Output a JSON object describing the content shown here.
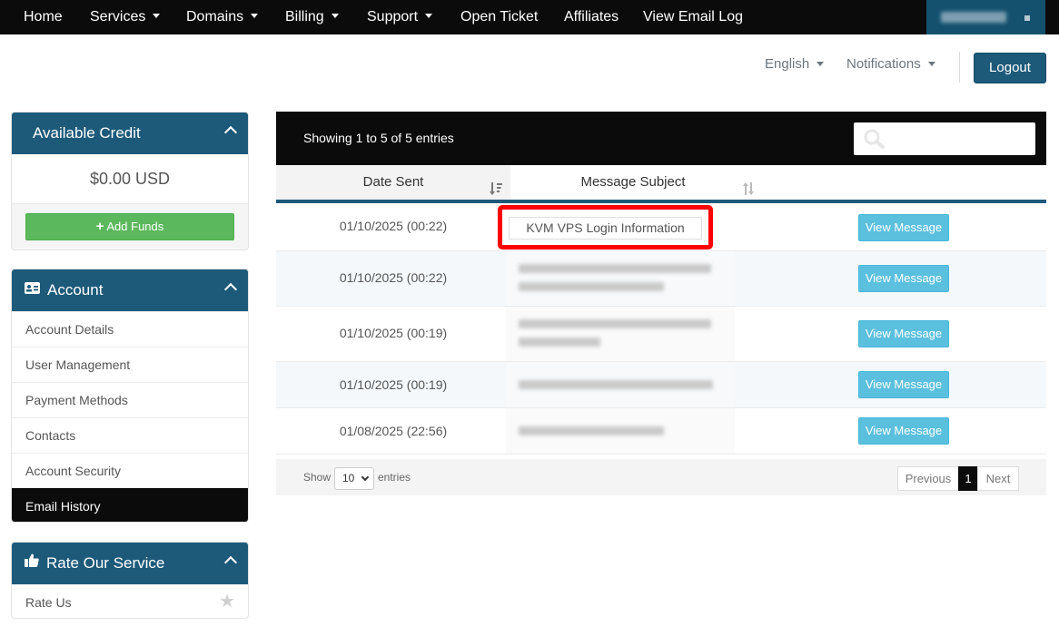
{
  "nav": {
    "items": [
      {
        "label": "Home"
      },
      {
        "label": "Services"
      },
      {
        "label": "Domains"
      },
      {
        "label": "Billing"
      },
      {
        "label": "Support"
      },
      {
        "label": "Open Ticket"
      },
      {
        "label": "Affiliates"
      },
      {
        "label": "View Email Log"
      }
    ]
  },
  "header": {
    "language": "English",
    "notifications": "Notifications",
    "logout": "Logout"
  },
  "sidebar": {
    "credit": {
      "title": "Available Credit",
      "amount": "$0.00 USD",
      "add_funds": "Add Funds"
    },
    "account": {
      "title": "Account",
      "items": [
        {
          "label": "Account Details"
        },
        {
          "label": "User Management"
        },
        {
          "label": "Payment Methods"
        },
        {
          "label": "Contacts"
        },
        {
          "label": "Account Security"
        },
        {
          "label": "Email History"
        }
      ],
      "active_item": "Email History"
    },
    "rate": {
      "title": "Rate Our Service",
      "item": "Rate Us"
    }
  },
  "table": {
    "showing": "Showing 1 to 5 of 5 entries",
    "columns": {
      "date": "Date Sent",
      "subject": "Message Subject"
    },
    "rows": [
      {
        "date": "01/10/2025 (00:22)",
        "subject": "KVM VPS Login Information",
        "action": "View Message"
      },
      {
        "date": "01/10/2025 (00:22)",
        "subject": "",
        "action": "View Message"
      },
      {
        "date": "01/10/2025 (00:19)",
        "subject": "",
        "action": "View Message"
      },
      {
        "date": "01/10/2025 (00:19)",
        "subject": "",
        "action": "View Message"
      },
      {
        "date": "01/08/2025 (22:56)",
        "subject": "",
        "action": "View Message"
      }
    ],
    "footer": {
      "show": "Show",
      "page_size": "10",
      "entries": "entries",
      "previous": "Previous",
      "page": "1",
      "next": "Next"
    }
  },
  "colors": {
    "nav_bg": "#0b0b0b",
    "brand_blue": "#1d5a7a",
    "info_button": "#5bc0de",
    "success_button": "#5cb85c",
    "highlight": "#ff0000"
  }
}
